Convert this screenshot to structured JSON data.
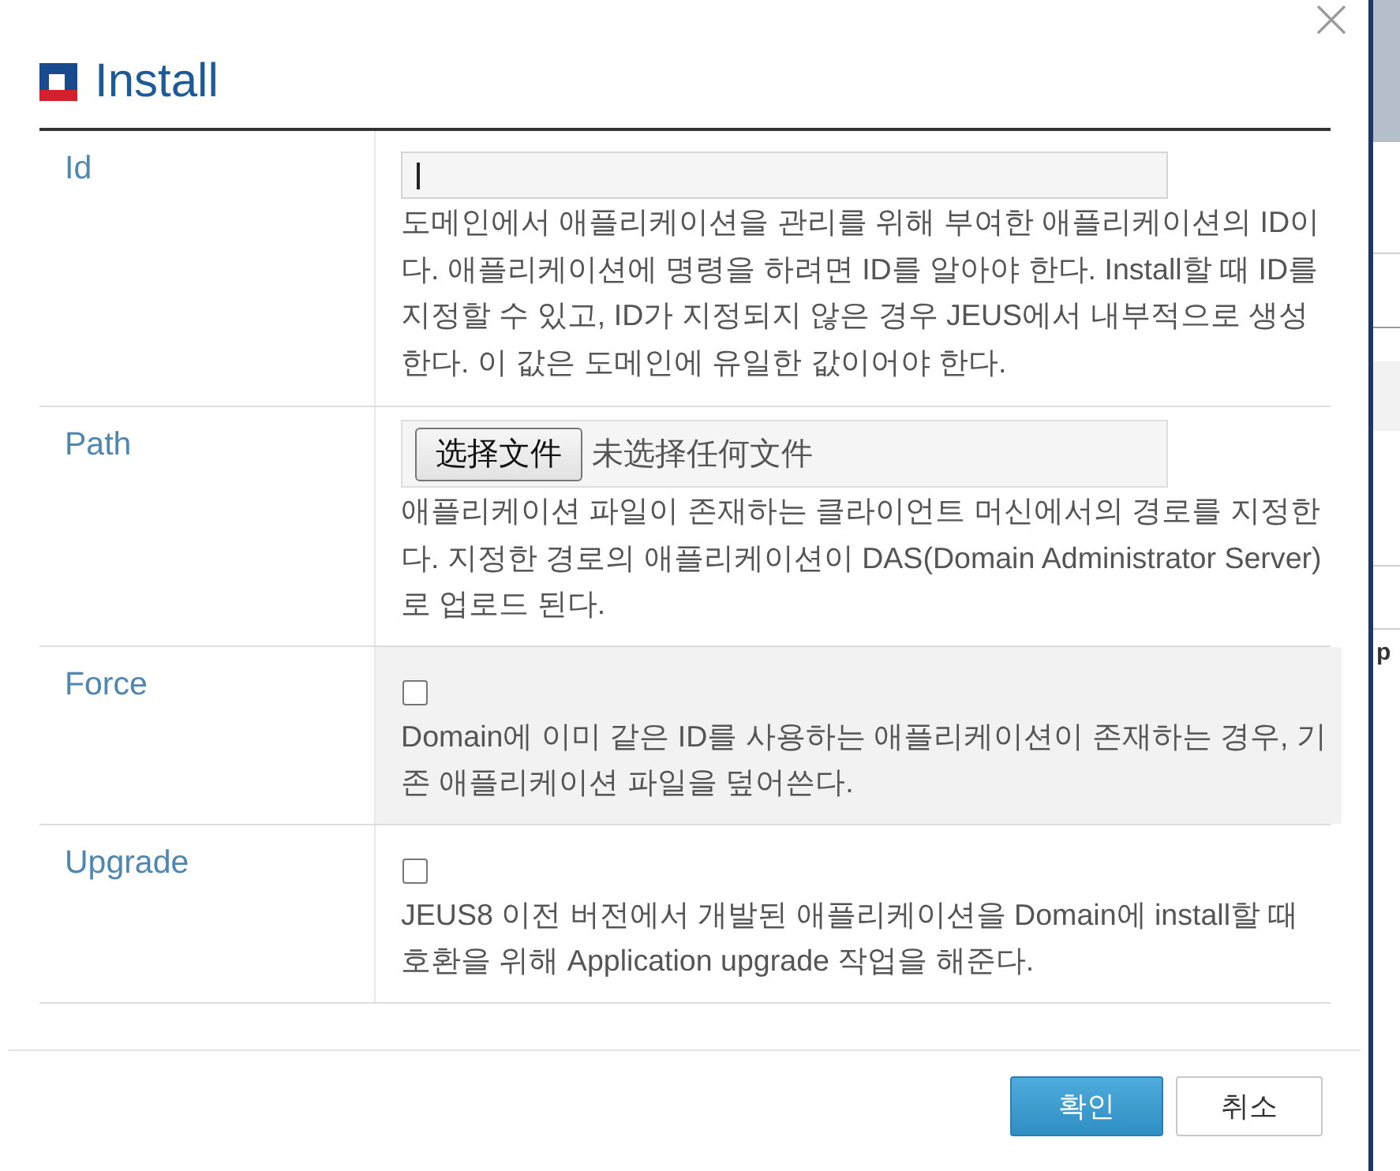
{
  "dialog": {
    "title": "Install"
  },
  "fields": [
    {
      "kind": "text",
      "label": "Id",
      "focused": true,
      "highlighted": false,
      "description": "도메인에서 애플리케이션을 관리를 위해 부여한 애플리케이션의 ID이다. 애플리케이션에 명령을 하려면 ID를 알아야 한다. Install할 때 ID를 지정할 수 있고, ID가 지정되지 않은 경우 JEUS에서 내부적으로 생성한다. 이 값은 도메인에 유일한 값이어야 한다."
    },
    {
      "kind": "file",
      "label": "Path",
      "button_label": "选择文件",
      "status": "未选择任何文件",
      "highlighted": false,
      "description": "애플리케이션 파일이 존재하는 클라이언트 머신에서의 경로를 지정한다. 지정한 경로의 애플리케이션이 DAS(Domain Administrator Server)로 업로드 된다."
    },
    {
      "kind": "checkbox",
      "label": "Force",
      "checked": false,
      "highlighted": true,
      "description": "Domain에 이미 같은 ID를 사용하는 애플리케이션이 존재하는 경우, 기존 애플리케이션 파일을 덮어쓴다."
    },
    {
      "kind": "checkbox",
      "label": "Upgrade",
      "checked": false,
      "highlighted": false,
      "description": "JEUS8 이전 버전에서 개발된 애플리케이션을 Domain에 install할 때 호환을 위해 Application upgrade 작업을 해준다."
    }
  ],
  "buttons": [
    {
      "kind": "primary",
      "label": "확인"
    },
    {
      "kind": "secondary",
      "label": "취소"
    }
  ],
  "background_page": {
    "cut_text": "p"
  }
}
